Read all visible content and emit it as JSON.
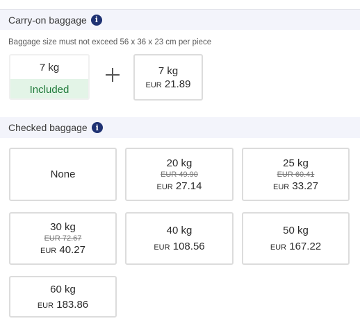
{
  "carry_on": {
    "title": "Carry-on baggage",
    "info_icon": "i",
    "note": "Baggage size must not exceed 56 x 36 x 23 cm per piece",
    "included": {
      "weight": "7 kg",
      "status": "Included"
    },
    "extra": {
      "weight": "7 kg",
      "currency": "EUR",
      "price": "21.89"
    }
  },
  "checked": {
    "title": "Checked baggage",
    "info_icon": "i",
    "options": [
      {
        "weight": "None"
      },
      {
        "weight": "20 kg",
        "old_price": "EUR 49.90",
        "currency": "EUR",
        "price": "27.14"
      },
      {
        "weight": "25 kg",
        "old_price": "EUR 60.41",
        "currency": "EUR",
        "price": "33.27"
      },
      {
        "weight": "30 kg",
        "old_price": "EUR 72.67",
        "currency": "EUR",
        "price": "40.27"
      },
      {
        "weight": "40 kg",
        "currency": "EUR",
        "price": "108.56"
      },
      {
        "weight": "50 kg",
        "currency": "EUR",
        "price": "167.22"
      },
      {
        "weight": "60 kg",
        "currency": "EUR",
        "price": "183.86"
      }
    ]
  },
  "colors": {
    "accent": "#1f3273",
    "included_bg": "#e3f4e7",
    "included_text": "#1f7a3a",
    "header_bg": "#f3f4fb"
  }
}
